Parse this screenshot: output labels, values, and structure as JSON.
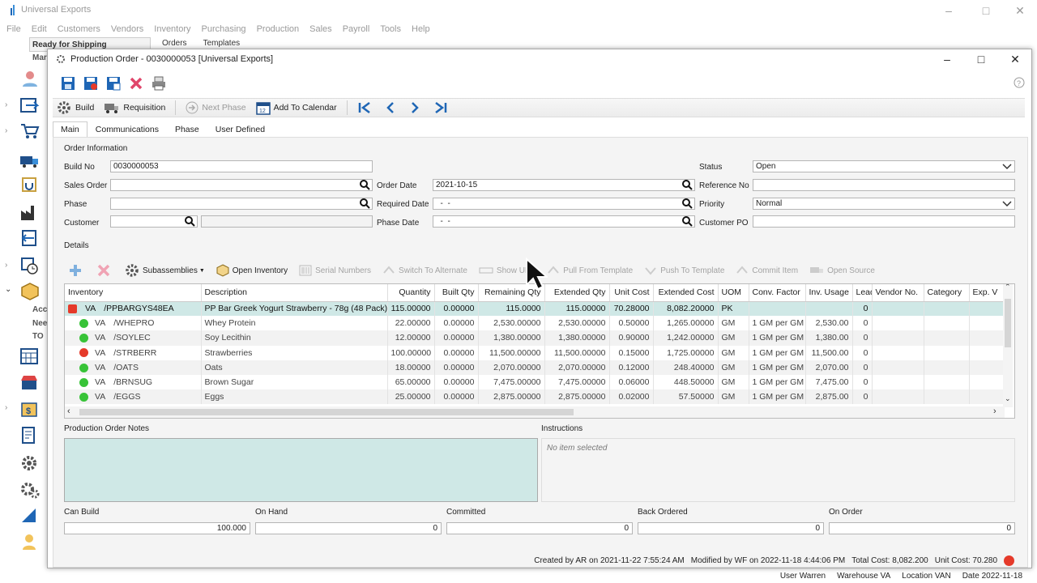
{
  "app": {
    "title": "Universal Exports",
    "menu": [
      "File",
      "Edit",
      "Customers",
      "Vendors",
      "Inventory",
      "Purchasing",
      "Production",
      "Sales",
      "Payroll",
      "Tools",
      "Help"
    ]
  },
  "background": {
    "panel_label": "Ready for Shipping",
    "tabs": [
      "Orders",
      "Templates"
    ],
    "side_labels": [
      "Mar",
      "Acc",
      "Nee",
      "TO"
    ]
  },
  "dialog": {
    "title": "Production Order - 0030000053 [Universal Exports]",
    "toolbar": {
      "build": "Build",
      "requisition": "Requisition",
      "next_phase": "Next Phase",
      "add_to_calendar": "Add To Calendar"
    },
    "tabs": [
      "Main",
      "Communications",
      "Phase",
      "User Defined"
    ],
    "order_info": {
      "section": "Order Information",
      "build_no_label": "Build No",
      "build_no": "0030000053",
      "sales_order_label": "Sales Order",
      "sales_order": "",
      "phase_label": "Phase",
      "phase": "",
      "customer_label": "Customer",
      "customer": "",
      "order_date_label": "Order Date",
      "order_date": "2021-10-15",
      "required_date_label": "Required Date",
      "required_date": "  -  -",
      "phase_date_label": "Phase Date",
      "phase_date": "  -  -",
      "status_label": "Status",
      "status": "Open",
      "reference_no_label": "Reference No",
      "reference_no": "",
      "priority_label": "Priority",
      "priority": "Normal",
      "customer_po_label": "Customer PO",
      "customer_po": ""
    },
    "details": {
      "section": "Details",
      "toolbar": {
        "subassemblies": "Subassemblies",
        "open_inventory": "Open Inventory",
        "serial_numbers": "Serial Numbers",
        "switch_to_alternate": "Switch To Alternate",
        "show_udf": "Show UDF",
        "pull_from_template": "Pull From Template",
        "push_to_template": "Push To Template",
        "commit_item": "Commit Item",
        "open_source": "Open Source"
      },
      "columns": [
        "Inventory",
        "Description",
        "Quantity",
        "Built Qty",
        "Remaining Qty",
        "Extended Qty",
        "Unit Cost",
        "Extended Cost",
        "UOM",
        "Conv. Factor",
        "Inv. Usage",
        "Lead",
        "Vendor No.",
        "Category",
        "Exp. V"
      ],
      "rows": [
        {
          "status": "red-square",
          "loc": "VA",
          "part": "/PPBARGYS48EA",
          "desc": "PP Bar Greek Yogurt Strawberry - 78g (48 Pack)",
          "qty": "115.00000",
          "built": "0.00000",
          "remaining": "115.0000",
          "extended": "115.00000",
          "unit_cost": "70.28000",
          "ext_cost": "8,082.20000",
          "uom": "PK",
          "conv": "",
          "usage": "",
          "lead": "0"
        },
        {
          "status": "green",
          "loc": "VA",
          "part": "/WHEPRO",
          "desc": "Whey Protein",
          "qty": "22.00000",
          "built": "0.00000",
          "remaining": "2,530.00000",
          "extended": "2,530.00000",
          "unit_cost": "0.50000",
          "ext_cost": "1,265.00000",
          "uom": "GM",
          "conv": "1 GM per GM",
          "usage": "2,530.00",
          "lead": "0"
        },
        {
          "status": "green",
          "loc": "VA",
          "part": "/SOYLEC",
          "desc": "Soy Lecithin",
          "qty": "12.00000",
          "built": "0.00000",
          "remaining": "1,380.00000",
          "extended": "1,380.00000",
          "unit_cost": "0.90000",
          "ext_cost": "1,242.00000",
          "uom": "GM",
          "conv": "1 GM per GM",
          "usage": "1,380.00",
          "lead": "0"
        },
        {
          "status": "red",
          "loc": "VA",
          "part": "/STRBERR",
          "desc": "Strawberries",
          "qty": "100.00000",
          "built": "0.00000",
          "remaining": "11,500.00000",
          "extended": "11,500.00000",
          "unit_cost": "0.15000",
          "ext_cost": "1,725.00000",
          "uom": "GM",
          "conv": "1 GM per GM",
          "usage": "11,500.00",
          "lead": "0"
        },
        {
          "status": "green",
          "loc": "VA",
          "part": "/OATS",
          "desc": "Oats",
          "qty": "18.00000",
          "built": "0.00000",
          "remaining": "2,070.00000",
          "extended": "2,070.00000",
          "unit_cost": "0.12000",
          "ext_cost": "248.40000",
          "uom": "GM",
          "conv": "1 GM per GM",
          "usage": "2,070.00",
          "lead": "0"
        },
        {
          "status": "green",
          "loc": "VA",
          "part": "/BRNSUG",
          "desc": "Brown Sugar",
          "qty": "65.00000",
          "built": "0.00000",
          "remaining": "7,475.00000",
          "extended": "7,475.00000",
          "unit_cost": "0.06000",
          "ext_cost": "448.50000",
          "uom": "GM",
          "conv": "1 GM per GM",
          "usage": "7,475.00",
          "lead": "0"
        },
        {
          "status": "green",
          "loc": "VA",
          "part": "/EGGS",
          "desc": "Eggs",
          "qty": "25.00000",
          "built": "0.00000",
          "remaining": "2,875.00000",
          "extended": "2,875.00000",
          "unit_cost": "0.02000",
          "ext_cost": "57.50000",
          "uom": "GM",
          "conv": "1 GM per GM",
          "usage": "2,875.00",
          "lead": "0"
        }
      ]
    },
    "notes_label": "Production Order Notes",
    "instructions_label": "Instructions",
    "instructions_empty": "No item selected",
    "summary": {
      "can_build_label": "Can Build",
      "can_build": "100.000",
      "on_hand_label": "On Hand",
      "on_hand": "0",
      "committed_label": "Committed",
      "committed": "0",
      "back_ordered_label": "Back Ordered",
      "back_ordered": "0",
      "on_order_label": "On Order",
      "on_order": "0"
    },
    "status_bar": {
      "created": "Created by AR on 2021-11-22 7:55:24 AM",
      "modified": "Modified by WF on 2022-11-18 4:44:06 PM",
      "total_cost": "Total Cost: 8,082.200",
      "unit_cost": "Unit Cost: 70.280"
    }
  },
  "footer": {
    "user": "User Warren",
    "warehouse": "Warehouse VA",
    "location": "Location VAN",
    "date": "Date 2022-11-18"
  },
  "colors": {
    "accent": "#1f66b5",
    "selection": "#cfe8e6",
    "status_red": "#e53a2a",
    "status_green": "#38c338"
  }
}
